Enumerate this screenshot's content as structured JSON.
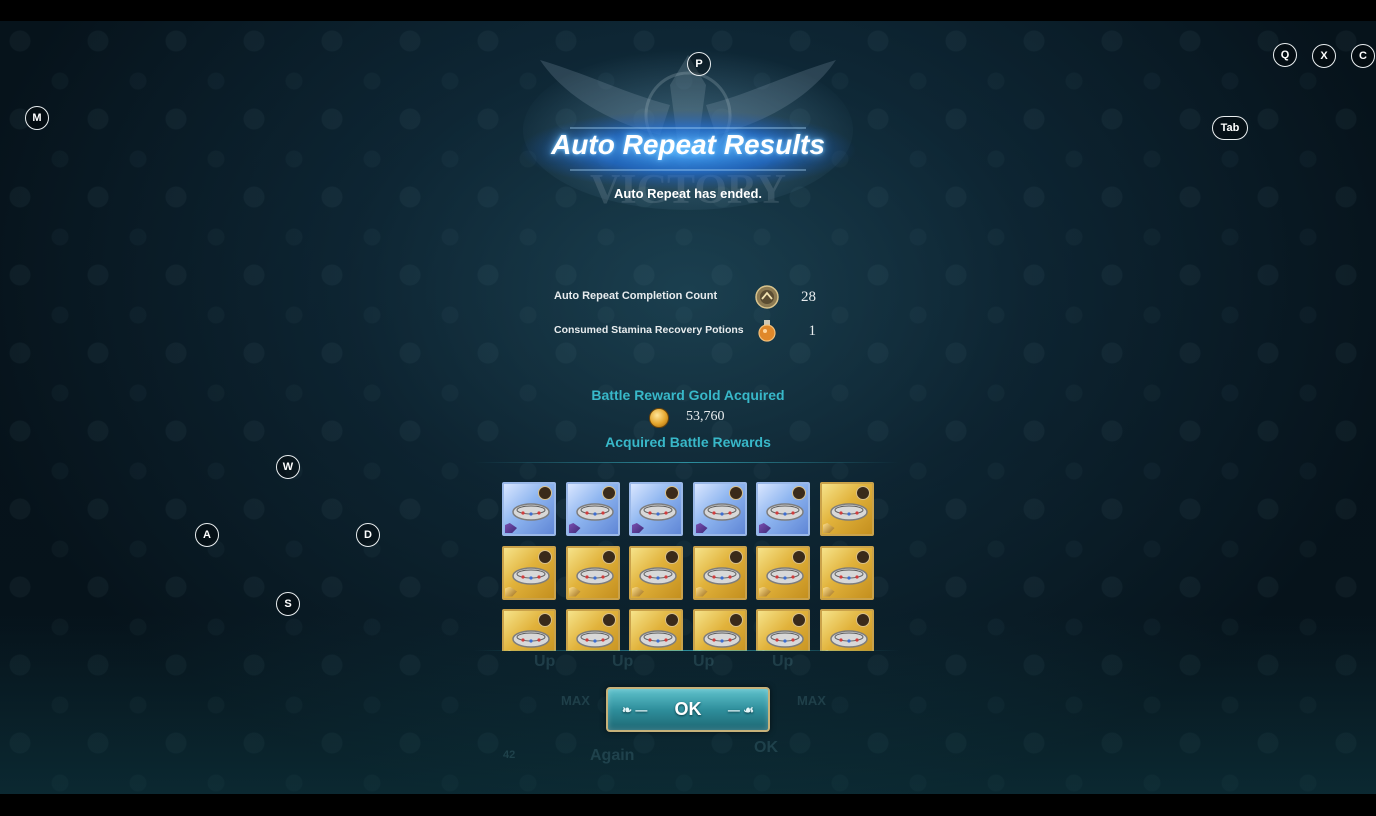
{
  "header": {
    "title": "Auto Repeat Results",
    "subtitle": "Auto Repeat has ended."
  },
  "stats": [
    {
      "label": "Auto Repeat Completion Count",
      "icon": "repeat-medal-icon",
      "value": "28"
    },
    {
      "label": "Consumed Stamina Recovery Potions",
      "icon": "stamina-potion-icon",
      "value": "1"
    }
  ],
  "gold": {
    "title": "Battle Reward Gold Acquired",
    "icon": "gold-coin-icon",
    "value": "53,760"
  },
  "rewards": {
    "title": "Acquired Battle Rewards",
    "items": [
      {
        "icon": "ring-equipment-icon",
        "rarity": "blue"
      },
      {
        "icon": "ring-equipment-icon",
        "rarity": "blue"
      },
      {
        "icon": "ring-equipment-icon",
        "rarity": "blue"
      },
      {
        "icon": "ring-equipment-icon",
        "rarity": "blue"
      },
      {
        "icon": "ring-equipment-icon",
        "rarity": "blue"
      },
      {
        "icon": "ring-equipment-icon",
        "rarity": "gold"
      },
      {
        "icon": "ring-equipment-icon",
        "rarity": "gold"
      },
      {
        "icon": "ring-equipment-icon",
        "rarity": "gold"
      },
      {
        "icon": "ring-equipment-icon",
        "rarity": "gold"
      },
      {
        "icon": "ring-equipment-icon",
        "rarity": "gold"
      },
      {
        "icon": "ring-equipment-icon",
        "rarity": "gold"
      },
      {
        "icon": "ring-equipment-icon",
        "rarity": "gold"
      },
      {
        "icon": "ring-equipment-icon",
        "rarity": "gold"
      },
      {
        "icon": "ring-equipment-icon",
        "rarity": "gold"
      },
      {
        "icon": "ring-equipment-icon",
        "rarity": "gold"
      },
      {
        "icon": "ring-equipment-icon",
        "rarity": "gold"
      },
      {
        "icon": "ring-equipment-icon",
        "rarity": "gold"
      },
      {
        "icon": "ring-equipment-icon",
        "rarity": "gold"
      }
    ]
  },
  "ok_button": {
    "label": "OK"
  },
  "background_ghost_text": {
    "up": "Up",
    "max": "MAX",
    "again": "Again",
    "ok": "OK",
    "count": "42"
  },
  "key_hints": {
    "p": "P",
    "q": "Q",
    "x": "X",
    "c": "C",
    "m": "M",
    "tab": "Tab",
    "w": "W",
    "a": "A",
    "s": "S",
    "d": "D"
  },
  "colors": {
    "section_title": "#38b8c9",
    "gold_frame": "#caa24a",
    "blue_frame": "#9ab8e8",
    "ok_button": "#2f8f9c"
  }
}
